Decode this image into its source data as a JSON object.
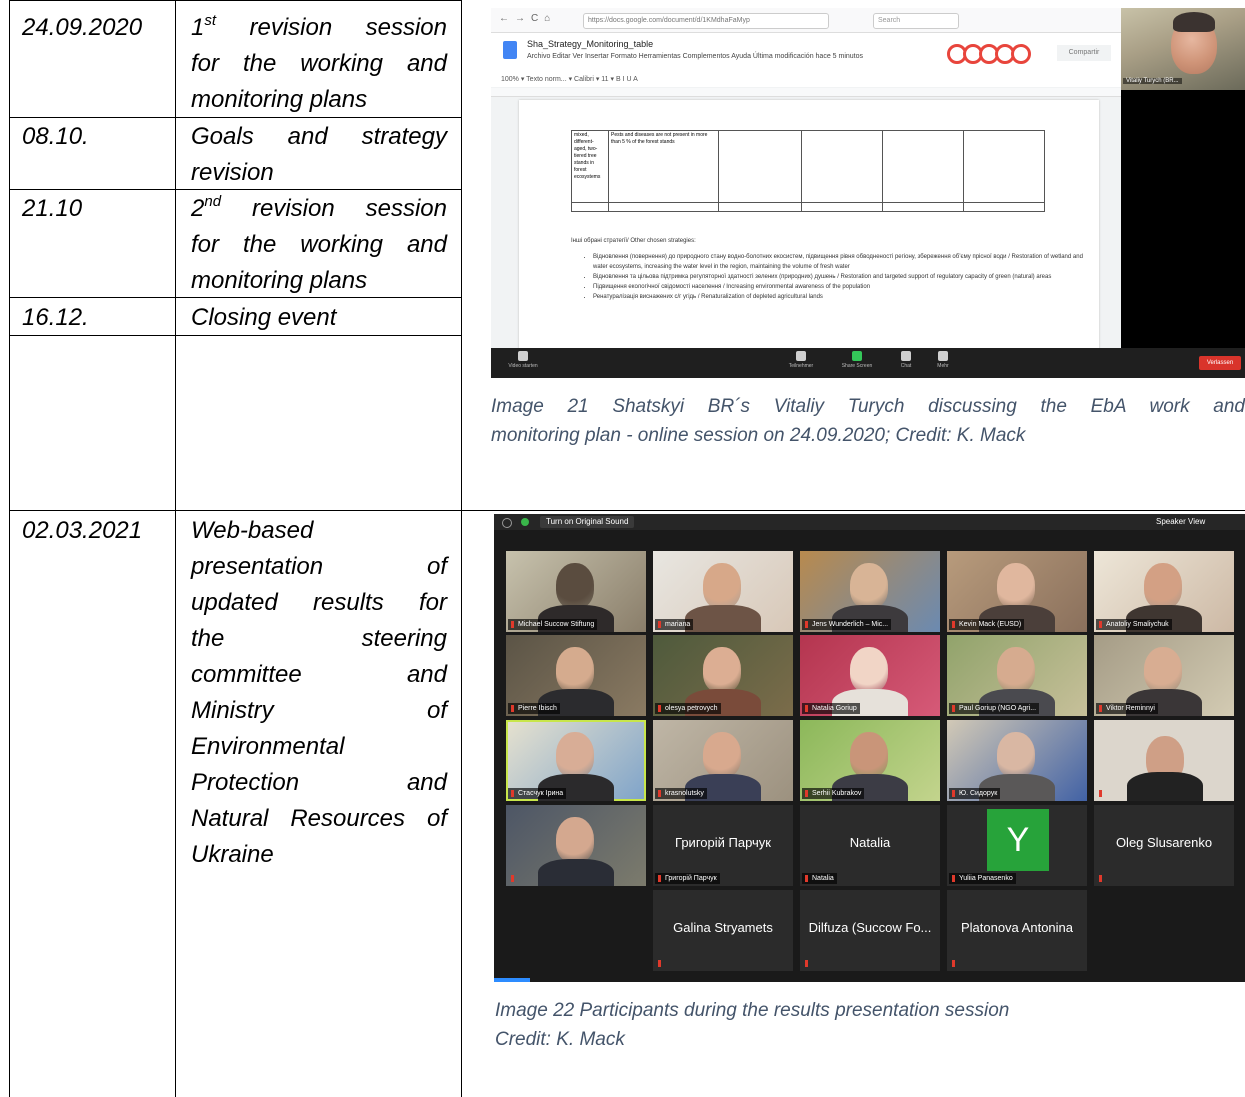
{
  "rows": [
    {
      "date": "24.09.2020",
      "event_lines": [
        "1",
        "st",
        " revision session",
        "for the working and",
        "monitoring plans"
      ]
    },
    {
      "date": "08.10.",
      "event_lines": [
        "Goals and strategy",
        "revision"
      ]
    },
    {
      "date": "21.10",
      "event_lines": [
        "2",
        "nd",
        " revision session",
        "for the working and",
        "monitoring plans"
      ]
    },
    {
      "date": "16.12.",
      "event_lines": [
        "Closing event"
      ]
    },
    {
      "date": "02.03.2021",
      "event_lines": [
        "Web-based",
        "presentation of",
        "updated results for",
        "the steering",
        "committee and",
        "Ministry of",
        "Environmental",
        "Protection and",
        "Natural Resources of",
        "Ukraine"
      ]
    }
  ],
  "captions": {
    "image21_line1": "Image 21 Shatskyi BR´s Vitaliy Turych discussing the EbA work and",
    "image21_line2": "monitoring plan - online session on 24.09.2020; Credit: K. Mack",
    "image22_line1": "Image 22 Participants during the results presentation session",
    "image22_line2": "Credit: K. Mack"
  },
  "screenshot1": {
    "url": "https://docs.google.com/document/d/1KMdhaFaMyp",
    "search": "Search",
    "doc_title": "Sha_Strategy_Monitoring_table",
    "menu": "Archivo  Editar  Ver  Insertar  Formato  Herramientas  Complementos  Ayuda    Última modificación hace 5 minutos",
    "share": "Compartir",
    "toolbar": "100%  ▾   Texto norm...  ▾   Calibri   ▾   11   ▾   B  I  U  A",
    "cell_a": "mixed, different-aged, two-tiered tree stands in forest ecosystems",
    "cell_b": "Pests and diseases are not present in more than 5 % of the forest stands",
    "other_strategies": "Інші обрані стратегії/ Other chosen strategies:",
    "bullets": [
      "Відновлення (повернення) до природного стану водно-болотних екосистем, підвищення рівня обводненості регіону, збереження об’єму прісної води / Restoration of wetland and water ecosystems, increasing the water level in the region, maintaining the volume of fresh water",
      "Відновлення та цільова підтримка регуляторної здатності зелених (природних) душень / Restoration and targeted support of regulatory capacity of green (natural) areas",
      "Підвищення екологічної свідомості населення / Increasing environmental awareness of the population",
      "Ренатуралізація виснажених с/г угідь / Renaturalization of depleted agricultural lands"
    ],
    "cam_name": "Vitaliy Turych (BR...",
    "zoom_buttons": [
      "Video starten",
      "Teilnehmer",
      "Share Screen",
      "Chat",
      "Mehr"
    ],
    "leave": "Verlassen"
  },
  "screenshot2": {
    "sound_button": "Turn on Original Sound",
    "view_button": "Speaker View",
    "tiles": [
      {
        "name": "Michael Succow Stiftung"
      },
      {
        "name": "mariana"
      },
      {
        "name": "Jens Wunderlich – Mic..."
      },
      {
        "name": "Kevin Mack (EUSD)"
      },
      {
        "name": "Anatoliy Smaliychuk"
      },
      {
        "name": "Pierre Ibisch"
      },
      {
        "name": "olesya petrovych"
      },
      {
        "name": "Natalia Goriup"
      },
      {
        "name": "Paul Goriup (NGO Agri..."
      },
      {
        "name": "Viktor Reminnyi"
      },
      {
        "name": "Стасчук Ірина"
      },
      {
        "name": "krasnolutsky"
      },
      {
        "name": "Serhii Kubrakov"
      },
      {
        "name": "Ю. Сидорук"
      },
      {
        "name": ""
      },
      {
        "name": ""
      },
      {
        "name": "Григорій Парчук",
        "big": "Григорій Парчук"
      },
      {
        "name": "Natalia",
        "big": "Natalia"
      },
      {
        "name": "Yuliia Panasenko",
        "letter": "Y"
      },
      {
        "name": "",
        "big": "Oleg Slusarenko"
      },
      {
        "name": "",
        "big": "Galina Stryamets"
      },
      {
        "name": "",
        "big": "Dilfuza (Succow Fo..."
      },
      {
        "name": "",
        "big": "Platonova Antonina"
      }
    ]
  }
}
